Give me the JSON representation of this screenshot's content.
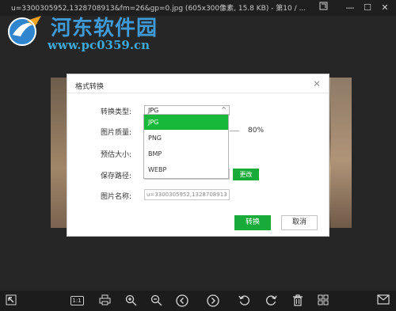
{
  "window": {
    "title": "u=3300305952,1328708913&fm=26&gp=0.jpg (605x300像素, 15.8 KB) - 第10 / ...",
    "minimize": "—",
    "maximize": "☐",
    "close": "✕",
    "pin": "⧉"
  },
  "watermark": {
    "title": "河东软件园",
    "url": "www.pc0359.cn"
  },
  "dialog": {
    "title": "格式转换",
    "close": "✕",
    "format_label": "转换类型:",
    "format_value": "JPG",
    "format_arrow": "^",
    "quality_label": "图片质量:",
    "quality_value": "80%",
    "size_label": "预估大小:",
    "path_label": "保存路径:",
    "change_button": "更改",
    "name_label": "图片名称:",
    "name_value": "u=3300305952,1328708913",
    "convert_button": "转换",
    "cancel_button": "取消"
  },
  "dropdown": {
    "options": [
      "JPG",
      "PNG",
      "BMP",
      "WEBP"
    ],
    "selected": "JPG"
  },
  "toolbar": {
    "actual_size": "1:1"
  },
  "colors": {
    "accent": "#18ab3a",
    "dropdown_highlight": "#18b83a",
    "watermark_blue": "#3f9ad8"
  }
}
